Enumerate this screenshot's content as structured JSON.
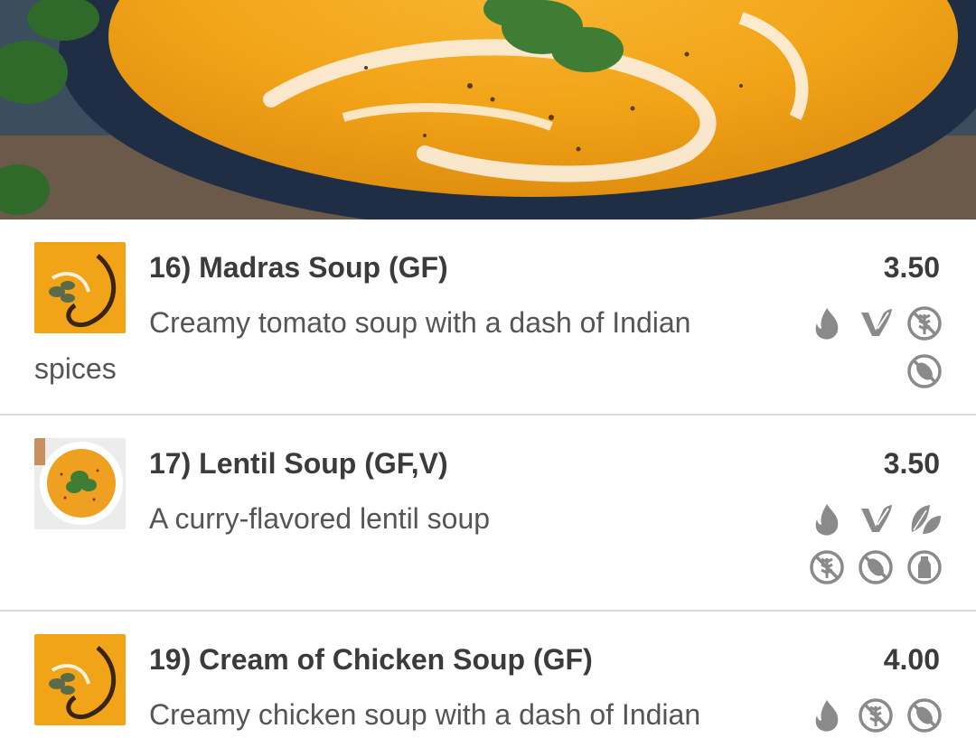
{
  "hero": {
    "image": "creamy-soup-bowl-photo"
  },
  "items": [
    {
      "title": "16) Madras Soup (GF)",
      "price": "3.50",
      "description": "Creamy tomato soup with a dash of Indian spices",
      "thumb": "swirl-soup-thumbnail",
      "icons": [
        "spicy-icon",
        "vegetarian-icon",
        "gluten-free-icon",
        "nut-free-icon"
      ]
    },
    {
      "title": "17) Lentil Soup (GF,V)",
      "price": "3.50",
      "description": "A curry-flavored lentil soup",
      "thumb": "lentil-soup-thumbnail",
      "icons": [
        "spicy-icon",
        "vegetarian-icon",
        "vegan-icon",
        "gluten-free-icon",
        "nut-free-icon",
        "dairy-free-icon"
      ]
    },
    {
      "title": "19) Cream of Chicken Soup (GF)",
      "price": "4.00",
      "description": "Creamy chicken soup with a dash of Indian",
      "thumb": "swirl-soup-thumbnail",
      "icons": [
        "spicy-icon",
        "gluten-free-icon",
        "nut-free-icon"
      ]
    }
  ],
  "colors": {
    "icon": "#8a8a8a",
    "soup": "#f2a418",
    "bowl": "#1f2e45",
    "divider": "#d9d9d9"
  }
}
